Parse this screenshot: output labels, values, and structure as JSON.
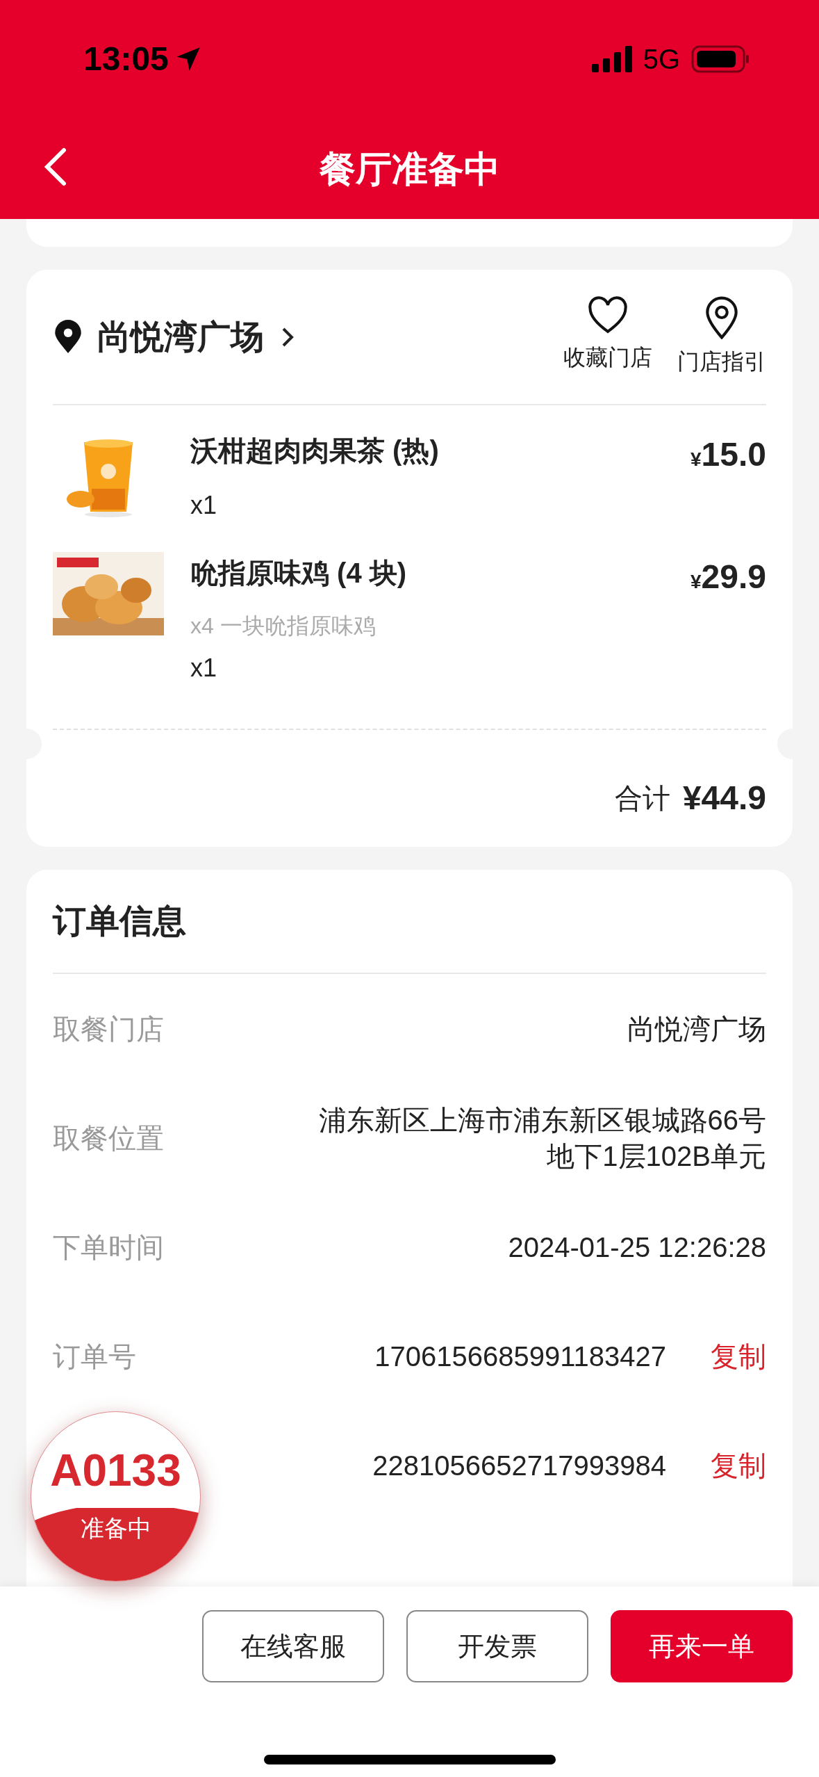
{
  "status_bar": {
    "time": "13:05",
    "network": "5G"
  },
  "nav": {
    "title": "餐厅准备中"
  },
  "store": {
    "name": "尚悦湾广场",
    "actions": [
      {
        "kind": "favorite",
        "label": "收藏门店"
      },
      {
        "kind": "guide",
        "label": "门店指引"
      }
    ]
  },
  "items": [
    {
      "kind": "drink",
      "name": "沃柑超肉肉果茶 (热)",
      "currency": "¥",
      "price": "15.0",
      "quantity": "x1"
    },
    {
      "kind": "chicken",
      "name": "吮指原味鸡 (4 块)",
      "options": "x4 一块吮指原味鸡",
      "currency": "¥",
      "price": "29.9",
      "quantity": "x1"
    }
  ],
  "total": {
    "label": "合计",
    "amount": "¥44.9"
  },
  "order_info": {
    "title": "订单信息",
    "rows": [
      {
        "label": "取餐门店",
        "value": "尚悦湾广场"
      },
      {
        "label": "取餐位置",
        "value": "浦东新区上海市浦东新区银城路66号地下1层102B单元"
      },
      {
        "label": "下单时间",
        "value": "2024-01-25 12:26:28"
      },
      {
        "label": "订单号",
        "value": "1706156685991183427",
        "action": "复制"
      },
      {
        "value": "2281056652717993984",
        "action": "复制"
      }
    ]
  },
  "badge": {
    "code": "A0133",
    "status": "准备中"
  },
  "buttons": [
    {
      "kind": "secondary",
      "label": "在线客服"
    },
    {
      "kind": "secondary",
      "label": "开发票"
    },
    {
      "kind": "primary",
      "label": "再来一单"
    }
  ]
}
